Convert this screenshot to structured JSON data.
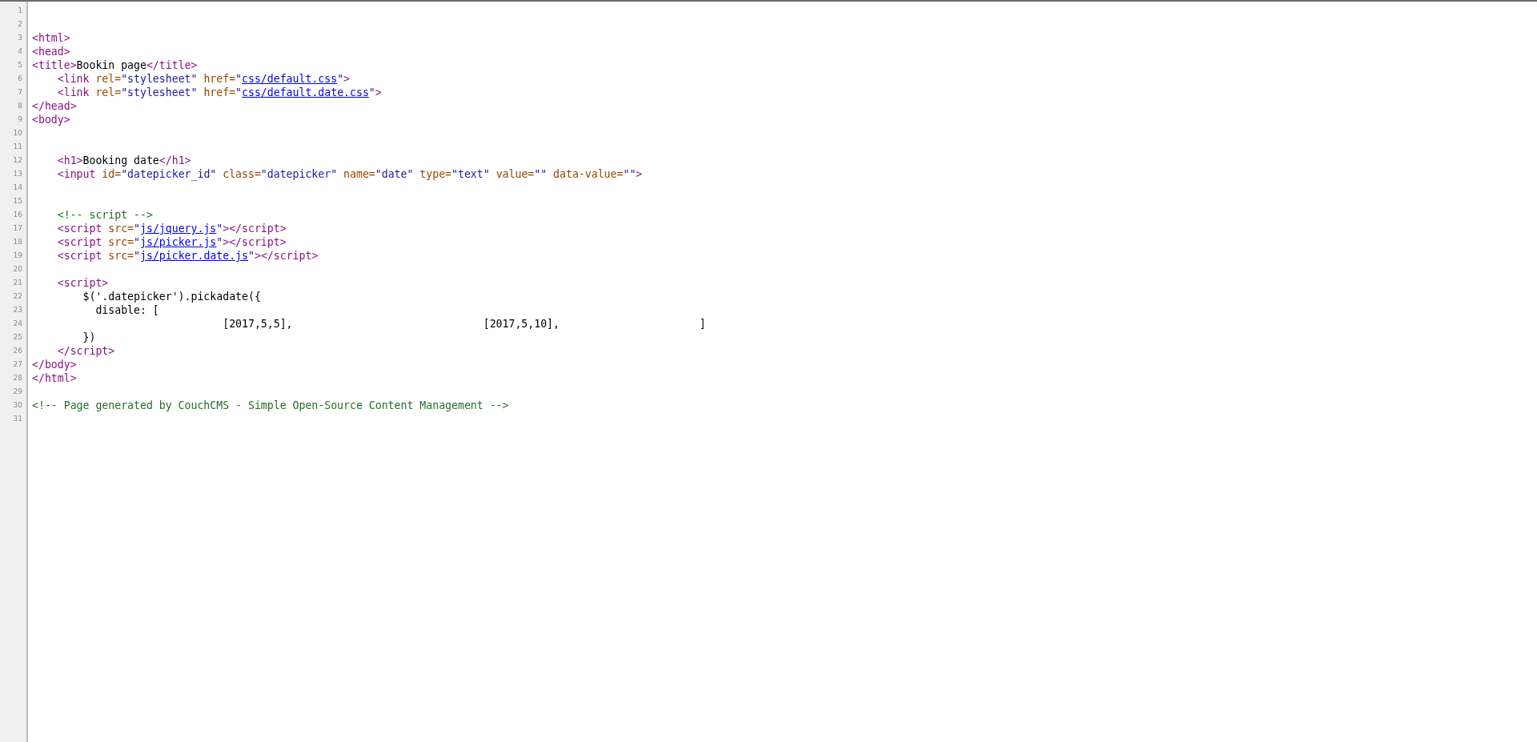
{
  "lines": [
    {
      "number": "1"
    },
    {
      "number": "2"
    },
    {
      "number": "3",
      "tokens": [
        {
          "kind": "tag",
          "text": "<html>"
        }
      ]
    },
    {
      "number": "4",
      "tokens": [
        {
          "kind": "tag",
          "text": "<head>"
        }
      ]
    },
    {
      "number": "5",
      "tokens": [
        {
          "kind": "tag",
          "text": "<title>"
        },
        {
          "kind": "text",
          "text": "Bookin page"
        },
        {
          "kind": "tag",
          "text": "</title>"
        }
      ]
    },
    {
      "number": "6",
      "tokens": [
        {
          "kind": "tag",
          "text": "    <link"
        },
        {
          "kind": "attr-name",
          "text": " rel="
        },
        {
          "kind": "attr-value",
          "text": "\"stylesheet\""
        },
        {
          "kind": "attr-name",
          "text": " href="
        },
        {
          "kind": "attr-value",
          "text": "\""
        },
        {
          "kind": "link",
          "text": "css/default.css"
        },
        {
          "kind": "attr-value",
          "text": "\""
        },
        {
          "kind": "tag",
          "text": ">"
        }
      ]
    },
    {
      "number": "7",
      "tokens": [
        {
          "kind": "tag",
          "text": "    <link"
        },
        {
          "kind": "attr-name",
          "text": " rel="
        },
        {
          "kind": "attr-value",
          "text": "\"stylesheet\""
        },
        {
          "kind": "attr-name",
          "text": " href="
        },
        {
          "kind": "attr-value",
          "text": "\""
        },
        {
          "kind": "link",
          "text": "css/default.date.css"
        },
        {
          "kind": "attr-value",
          "text": "\""
        },
        {
          "kind": "tag",
          "text": ">"
        }
      ]
    },
    {
      "number": "8",
      "tokens": [
        {
          "kind": "tag",
          "text": "</head>"
        }
      ]
    },
    {
      "number": "9",
      "tokens": [
        {
          "kind": "tag",
          "text": "<body>"
        }
      ]
    },
    {
      "number": "10"
    },
    {
      "number": "11"
    },
    {
      "number": "12",
      "tokens": [
        {
          "kind": "tag",
          "text": "    <h1>"
        },
        {
          "kind": "text",
          "text": "Booking date"
        },
        {
          "kind": "tag",
          "text": "</h1>"
        }
      ]
    },
    {
      "number": "13",
      "tokens": [
        {
          "kind": "tag",
          "text": "    <input"
        },
        {
          "kind": "attr-name",
          "text": " id="
        },
        {
          "kind": "attr-value",
          "text": "\"datepicker_id\""
        },
        {
          "kind": "attr-name",
          "text": " class="
        },
        {
          "kind": "attr-value",
          "text": "\"datepicker\""
        },
        {
          "kind": "attr-name",
          "text": " name="
        },
        {
          "kind": "attr-value",
          "text": "\"date\""
        },
        {
          "kind": "attr-name",
          "text": " type="
        },
        {
          "kind": "attr-value",
          "text": "\"text\""
        },
        {
          "kind": "attr-name",
          "text": " value="
        },
        {
          "kind": "attr-value",
          "text": "\"\""
        },
        {
          "kind": "attr-name",
          "text": " data-value="
        },
        {
          "kind": "attr-value",
          "text": "\"\""
        },
        {
          "kind": "tag",
          "text": ">"
        }
      ]
    },
    {
      "number": "14"
    },
    {
      "number": "15"
    },
    {
      "number": "16",
      "tokens": [
        {
          "kind": "comment",
          "text": "    <!-- script -->"
        }
      ]
    },
    {
      "number": "17",
      "tokens": [
        {
          "kind": "tag",
          "text": "    <script"
        },
        {
          "kind": "attr-name",
          "text": " src="
        },
        {
          "kind": "attr-value",
          "text": "\""
        },
        {
          "kind": "link",
          "text": "js/jquery.js"
        },
        {
          "kind": "attr-value",
          "text": "\""
        },
        {
          "kind": "tag",
          "text": "></script>"
        }
      ]
    },
    {
      "number": "18",
      "tokens": [
        {
          "kind": "tag",
          "text": "    <script"
        },
        {
          "kind": "attr-name",
          "text": " src="
        },
        {
          "kind": "attr-value",
          "text": "\""
        },
        {
          "kind": "link",
          "text": "js/picker.js"
        },
        {
          "kind": "attr-value",
          "text": "\""
        },
        {
          "kind": "tag",
          "text": "></script>"
        }
      ]
    },
    {
      "number": "19",
      "tokens": [
        {
          "kind": "tag",
          "text": "    <script"
        },
        {
          "kind": "attr-name",
          "text": " src="
        },
        {
          "kind": "attr-value",
          "text": "\""
        },
        {
          "kind": "link",
          "text": "js/picker.date.js"
        },
        {
          "kind": "attr-value",
          "text": "\""
        },
        {
          "kind": "tag",
          "text": "></script>"
        }
      ]
    },
    {
      "number": "20"
    },
    {
      "number": "21",
      "tokens": [
        {
          "kind": "tag",
          "text": "    <script>"
        }
      ]
    },
    {
      "number": "22",
      "tokens": [
        {
          "kind": "text",
          "text": "        $('.datepicker').pickadate({"
        }
      ]
    },
    {
      "number": "23",
      "tokens": [
        {
          "kind": "text",
          "text": "          disable: ["
        }
      ]
    },
    {
      "number": "24",
      "tokens": [
        {
          "kind": "text",
          "text": "                              [2017,5,5],                              [2017,5,10],                      ]"
        }
      ]
    },
    {
      "number": "25",
      "tokens": [
        {
          "kind": "text",
          "text": "        })"
        }
      ]
    },
    {
      "number": "26",
      "tokens": [
        {
          "kind": "tag",
          "text": "    </script>"
        }
      ]
    },
    {
      "number": "27",
      "tokens": [
        {
          "kind": "tag",
          "text": "</body>"
        }
      ]
    },
    {
      "number": "28",
      "tokens": [
        {
          "kind": "tag",
          "text": "</html>"
        }
      ]
    },
    {
      "number": "29"
    },
    {
      "number": "30",
      "tokens": [
        {
          "kind": "comment",
          "text": "<!-- Page generated by CouchCMS - Simple Open-Source Content Management -->"
        }
      ]
    },
    {
      "number": "31"
    }
  ]
}
